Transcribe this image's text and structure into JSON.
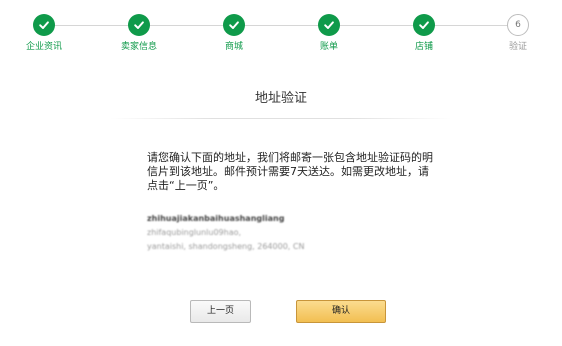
{
  "stepper": {
    "steps": [
      {
        "label": "企业资讯",
        "status": "done"
      },
      {
        "label": "卖家信息",
        "status": "done"
      },
      {
        "label": "商城",
        "status": "done"
      },
      {
        "label": "账单",
        "status": "done"
      },
      {
        "label": "店铺",
        "status": "done"
      },
      {
        "label": "验证",
        "status": "current",
        "number": "6"
      }
    ],
    "done_color": "#0f9a4a",
    "pending_color": "#9a9a9a"
  },
  "page": {
    "title": "地址验证",
    "instruction": "请您确认下面的地址，我们将邮寄一张包含地址验证码的明信片到该地址。邮件预计需要7天送达。如需更改地址，请点击“上一页”。"
  },
  "address": {
    "line1": "zhihuajiakanbaihuashangliang",
    "line2": "zhifaqubinglunlu09hao,",
    "line3": "yantaishi, shandongsheng, 264000, CN"
  },
  "buttons": {
    "prev_label": "上一页",
    "confirm_label": "确认",
    "confirm_color": "#f2bf52"
  }
}
